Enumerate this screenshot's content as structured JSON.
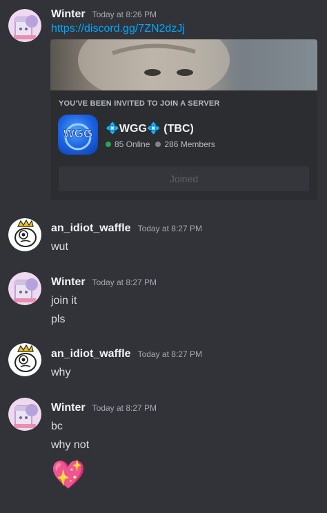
{
  "colors": {
    "background": "#313338",
    "link": "#00a8fc",
    "online_dot": "#23a55a",
    "members_dot": "#80848e"
  },
  "messages": [
    {
      "username": "Winter",
      "timestamp": "Today at 8:26 PM",
      "avatar": "winter-avatar",
      "lines": [
        "https://discord.gg/7ZN2dzJj"
      ]
    },
    {
      "username": "an_idiot_waffle",
      "timestamp": "Today at 8:27 PM",
      "avatar": "waffle-avatar",
      "lines": [
        "wut"
      ]
    },
    {
      "username": "Winter",
      "timestamp": "Today at 8:27 PM",
      "avatar": "winter-avatar",
      "lines": [
        "join it",
        "pls"
      ]
    },
    {
      "username": "an_idiot_waffle",
      "timestamp": "Today at 8:27 PM",
      "avatar": "waffle-avatar",
      "lines": [
        "why"
      ]
    },
    {
      "username": "Winter",
      "timestamp": "Today at 8:27 PM",
      "avatar": "winter-avatar",
      "lines": [
        "bc",
        "why not"
      ],
      "emoji": "💖"
    }
  ],
  "invite": {
    "heading": "YOU'VE BEEN INVITED TO JOIN A SERVER",
    "server_icon_text": "WGG",
    "server_name": "💠WGG💠 (TBC)",
    "online": "85 Online",
    "members": "286 Members",
    "button_label": "Joined"
  }
}
